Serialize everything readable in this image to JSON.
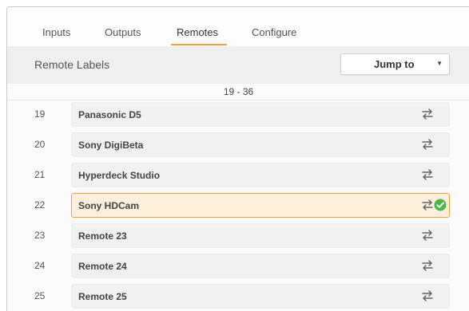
{
  "tabs": [
    {
      "label": "Inputs"
    },
    {
      "label": "Outputs"
    },
    {
      "label": "Remotes"
    },
    {
      "label": "Configure"
    }
  ],
  "active_tab": "Remotes",
  "toolbar": {
    "title": "Remote Labels",
    "jump_label": "Jump to"
  },
  "range": "19 - 36",
  "rows": [
    {
      "number": "19",
      "label": "Panasonic D5",
      "selected": false
    },
    {
      "number": "20",
      "label": "Sony DigiBeta",
      "selected": false
    },
    {
      "number": "21",
      "label": "Hyperdeck Studio",
      "selected": false
    },
    {
      "number": "22",
      "label": "Sony HDCam",
      "selected": true
    },
    {
      "number": "23",
      "label": "Remote 23",
      "selected": false
    },
    {
      "number": "24",
      "label": "Remote 24",
      "selected": false
    },
    {
      "number": "25",
      "label": "Remote 25",
      "selected": false
    }
  ],
  "icons": {
    "swap": "swap-arrows-icon",
    "check": "checkmark-icon",
    "dropdown": "caret-down-icon"
  },
  "colors": {
    "accent": "#f0a23a",
    "selected_bg": "#fcf0dc",
    "confirm_green": "#46b94a"
  }
}
